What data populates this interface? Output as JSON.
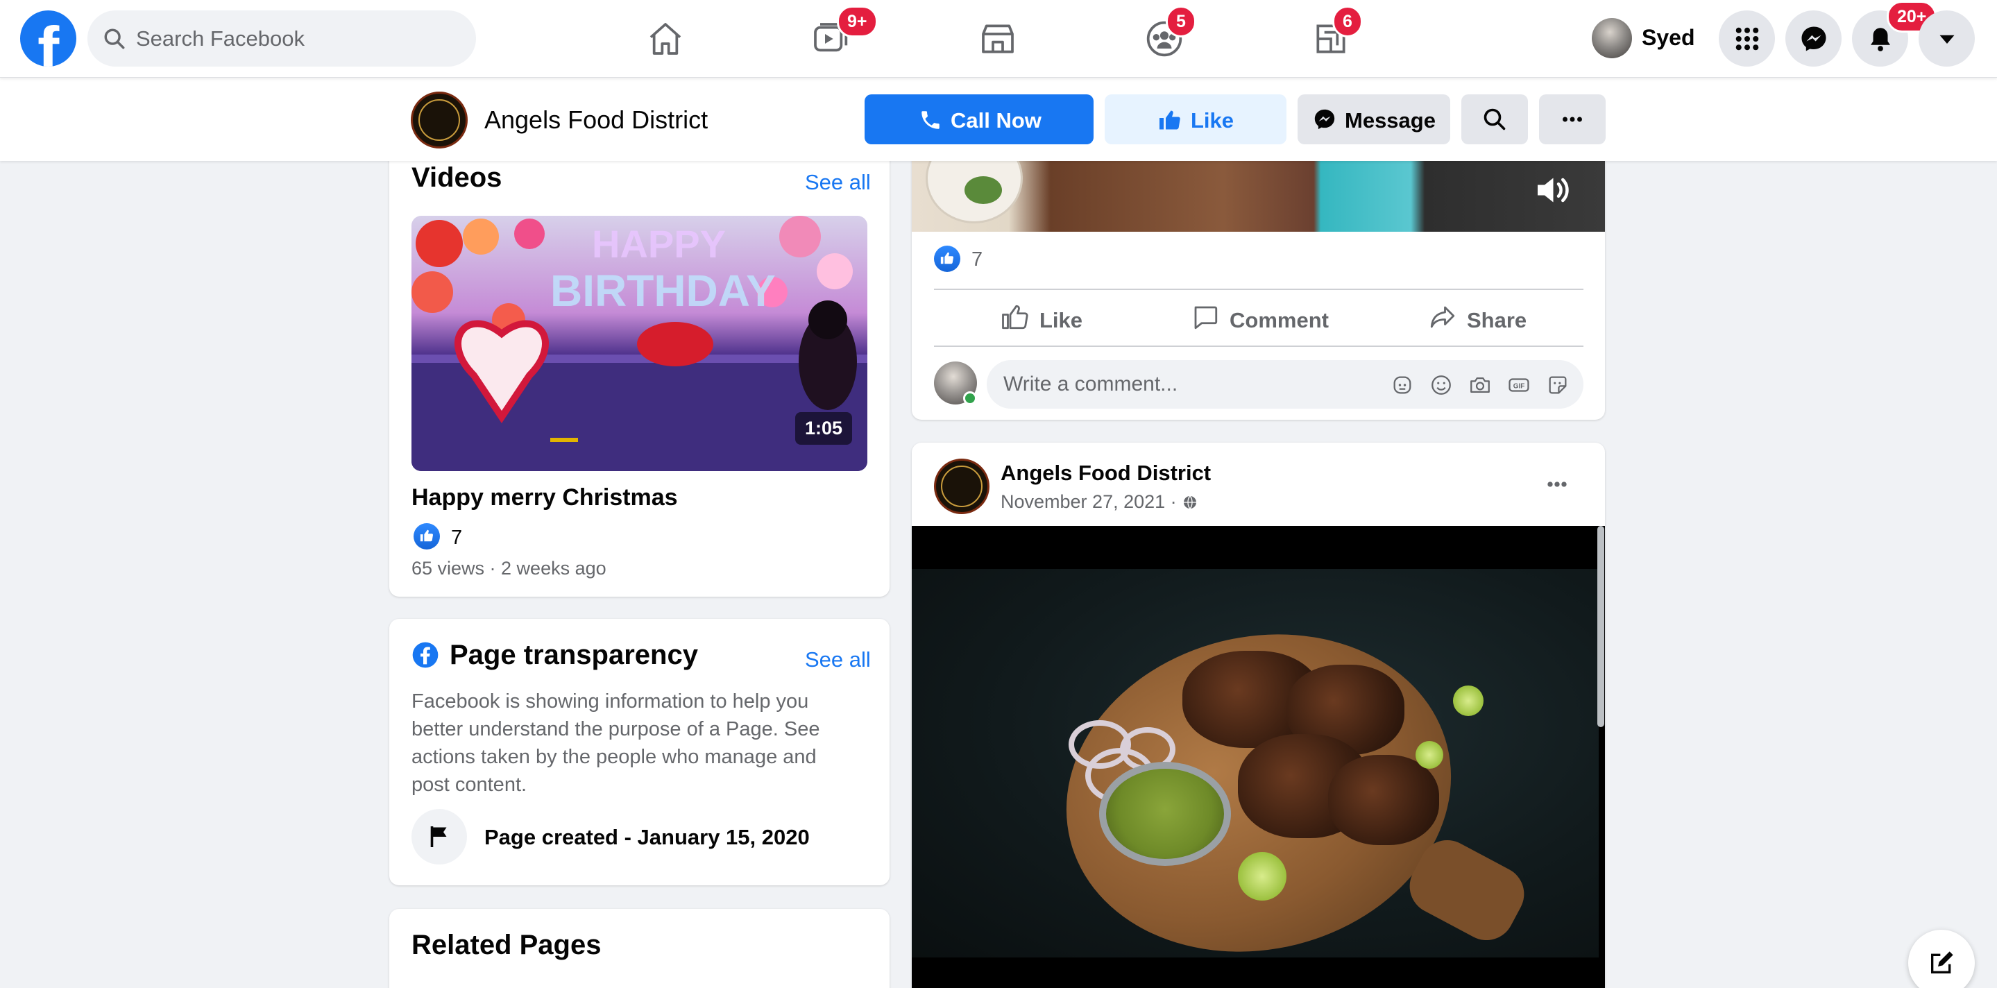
{
  "topnav": {
    "search_placeholder": "Search Facebook",
    "badges": {
      "watch": "9+",
      "groups": "5",
      "gaming": "6",
      "notifications": "20+"
    },
    "user_name": "Syed"
  },
  "page_header": {
    "page_name": "Angels Food District",
    "call_label": "Call Now",
    "like_label": "Like",
    "message_label": "Message"
  },
  "videos": {
    "title": "Videos",
    "see_all": "See all",
    "duration": "1:05",
    "video_title": "Happy merry Christmas",
    "like_count": "7",
    "meta": "65 views · 2 weeks ago"
  },
  "transparency": {
    "title": "Page transparency",
    "see_all": "See all",
    "description": "Facebook is showing information to help you better understand the purpose of a Page. See actions taken by the people who manage and post content.",
    "created": "Page created - January 15, 2020"
  },
  "related": {
    "title": "Related Pages"
  },
  "post1": {
    "reaction_count": "7",
    "actions": {
      "like": "Like",
      "comment": "Comment",
      "share": "Share"
    },
    "comment_placeholder": "Write a comment..."
  },
  "post2": {
    "author": "Angels Food District",
    "date": "November 27, 2021 ·"
  },
  "colors": {
    "brand_blue": "#1877f2",
    "badge_red": "#e41e3f",
    "bg": "#f0f2f5"
  }
}
